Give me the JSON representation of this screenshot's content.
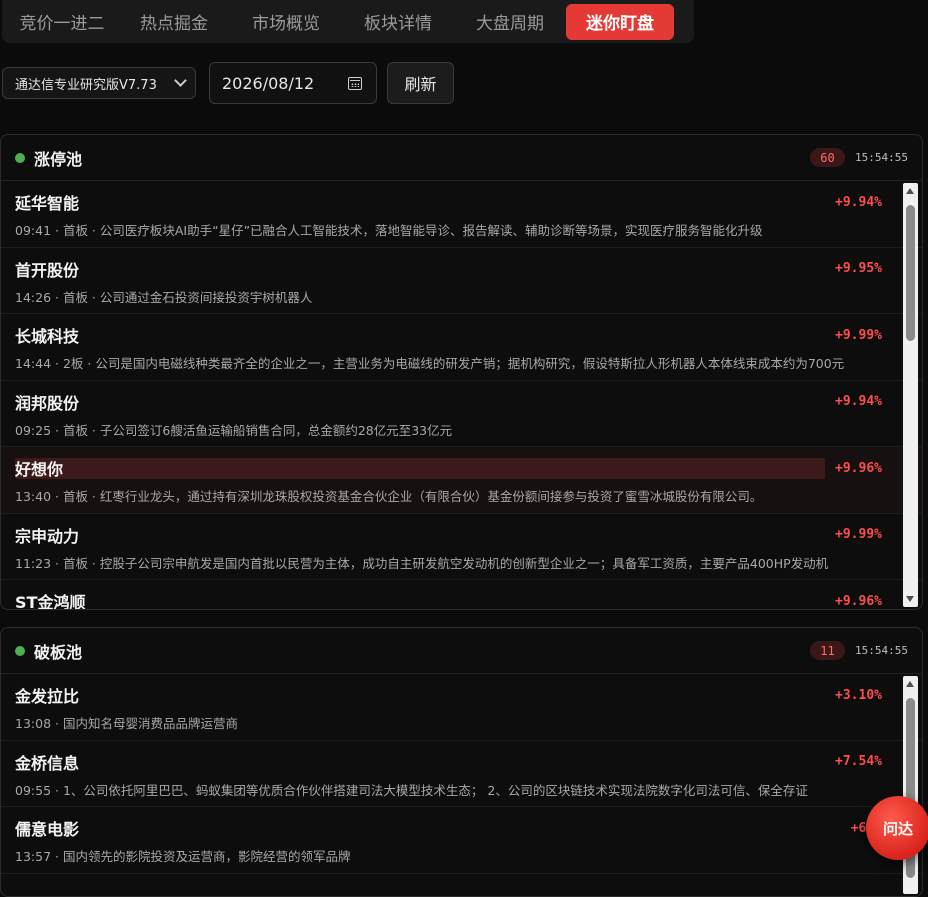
{
  "tabs": [
    {
      "label": "竞价一进二"
    },
    {
      "label": "热点掘金"
    },
    {
      "label": "市场概览"
    },
    {
      "label": "板块详情"
    },
    {
      "label": "大盘周期"
    },
    {
      "label": "迷你盯盘",
      "active": true
    }
  ],
  "toolbar": {
    "version_select": "通达信专业研究版V7.73",
    "date_value": "2026/08/12",
    "refresh_label": "刷新"
  },
  "limit_up_pool": {
    "title": "涨停池",
    "count": "60",
    "time": "15:54:55",
    "items": [
      {
        "name": "延华智能",
        "pct": "+9.94%",
        "desc": "09:41 · 首板 · 公司医疗板块AI助手“星仔”已融合人工智能技术，落地智能导诊、报告解读、辅助诊断等场景，实现医疗服务智能化升级"
      },
      {
        "name": "首开股份",
        "pct": "+9.95%",
        "desc": "14:26 · 首板 · 公司通过金石投资间接投资宇树机器人"
      },
      {
        "name": "长城科技",
        "pct": "+9.99%",
        "desc": "14:44 · 2板 · 公司是国内电磁线种类最齐全的企业之一，主营业务为电磁线的研发产销；据机构研究，假设特斯拉人形机器人本体线束成本约为700元"
      },
      {
        "name": "润邦股份",
        "pct": "+9.94%",
        "desc": "09:25 · 首板 · 子公司签订6艘活鱼运输船销售合同，总金额约28亿元至33亿元"
      },
      {
        "name": "好想你",
        "pct": "+9.96%",
        "desc": "13:40 · 首板 · 红枣行业龙头，通过持有深圳龙珠股权投资基金合伙企业（有限合伙）基金份额间接参与投资了蜜雪冰城股份有限公司。",
        "highlight": true
      },
      {
        "name": "宗申动力",
        "pct": "+9.99%",
        "desc": "11:23 · 首板 · 控股子公司宗申航发是国内首批以民营为主体，成功自主研发航空发动机的创新型企业之一；具备军工资质，主要产品400HP发动机"
      },
      {
        "name": "ST金鸿顺",
        "pct": "+9.96%",
        "desc": ""
      }
    ]
  },
  "broken_pool": {
    "title": "破板池",
    "count": "11",
    "time": "15:54:55",
    "items": [
      {
        "name": "金发拉比",
        "pct": "+3.10%",
        "desc": "13:08 · 国内知名母婴消费品品牌运营商"
      },
      {
        "name": "金桥信息",
        "pct": "+7.54%",
        "desc": "09:55 · 1、公司依托阿里巴巴、蚂蚁集团等优质合作伙伴搭建司法大模型技术生态； 2、公司的区块链技术实现法院数字化司法可信、保全存证"
      },
      {
        "name": "儒意电影",
        "pct": "+6.5",
        "desc": "13:57 · 国内领先的影院投资及运营商，影院经营的领军品牌"
      }
    ]
  },
  "ask_button": "问达",
  "colors": {
    "accent": "#e53935",
    "up": "#ff4d4f",
    "live_dot": "#4caf50"
  }
}
